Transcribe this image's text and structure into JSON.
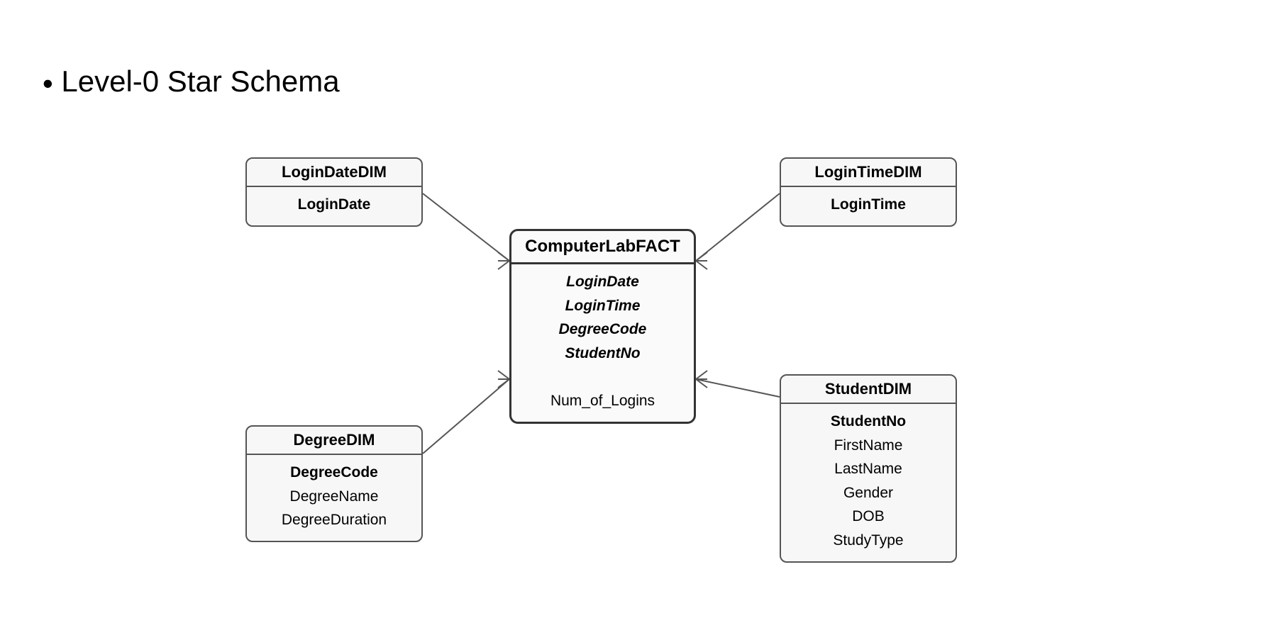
{
  "title": "Level-0 Star Schema",
  "fact": {
    "name": "ComputerLabFACT",
    "keys": [
      "LoginDate",
      "LoginTime",
      "DegreeCode",
      "StudentNo"
    ],
    "measure": "Num_of_Logins"
  },
  "dims": {
    "loginDate": {
      "name": "LoginDateDIM",
      "pk": "LoginDate",
      "attrs": []
    },
    "loginTime": {
      "name": "LoginTimeDIM",
      "pk": "LoginTime",
      "attrs": []
    },
    "degree": {
      "name": "DegreeDIM",
      "pk": "DegreeCode",
      "attrs": [
        "DegreeName",
        "DegreeDuration"
      ]
    },
    "student": {
      "name": "StudentDIM",
      "pk": "StudentNo",
      "attrs": [
        "FirstName",
        "LastName",
        "Gender",
        "DOB",
        "StudyType"
      ]
    }
  }
}
